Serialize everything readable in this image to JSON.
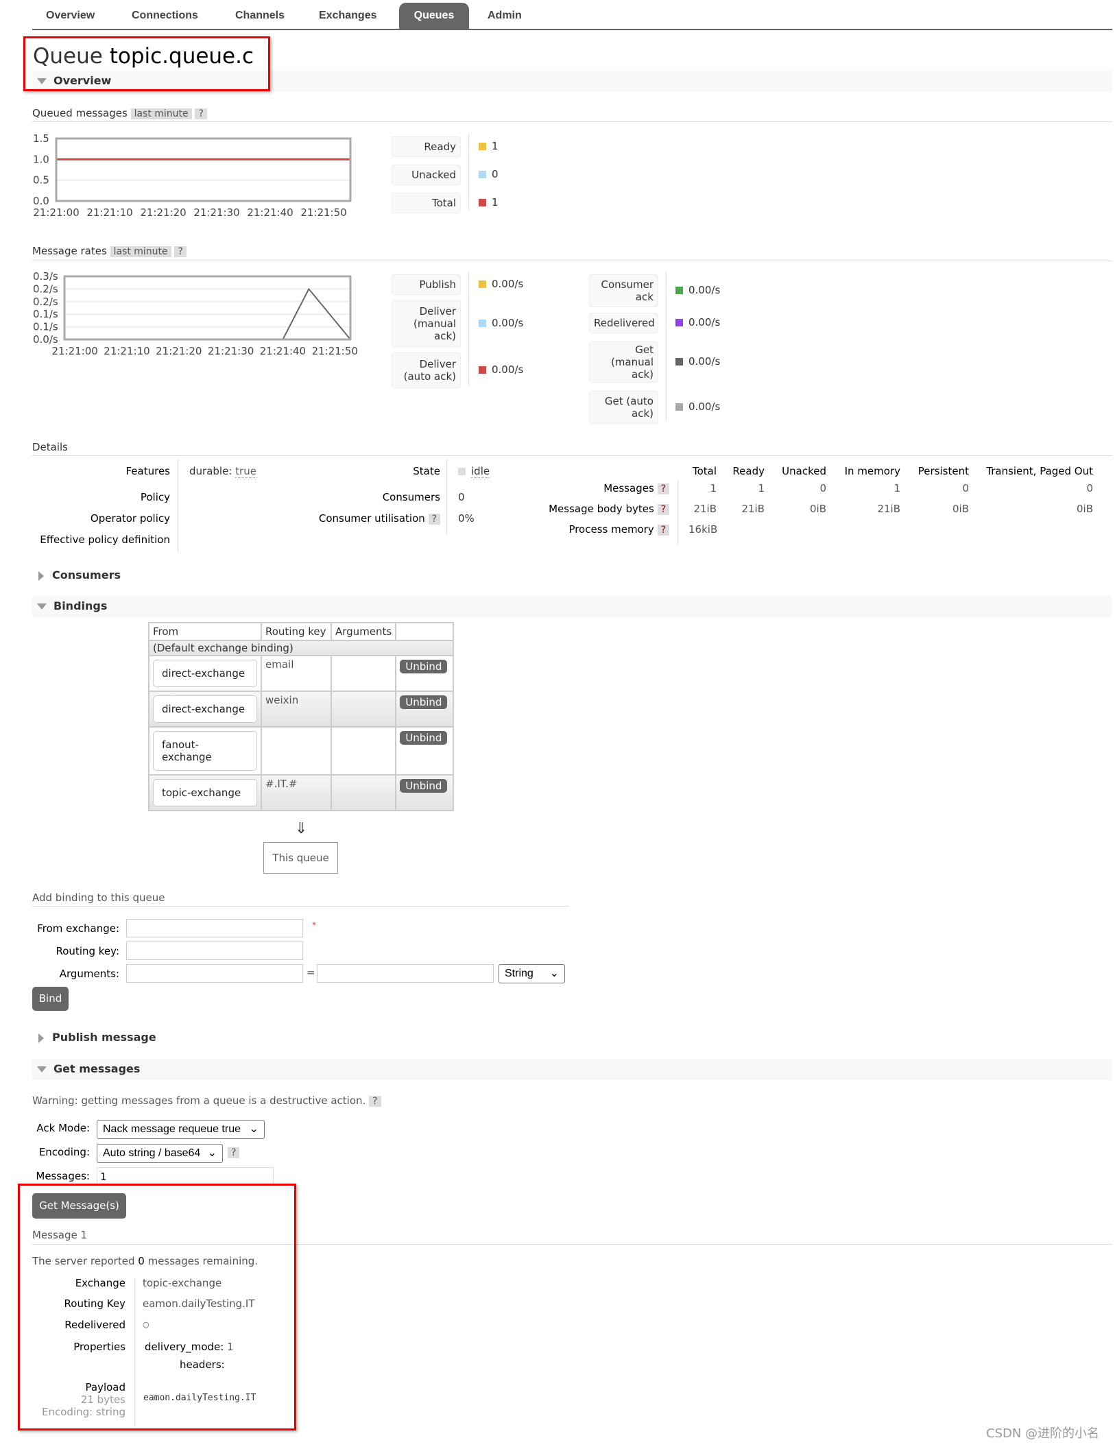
{
  "nav": {
    "tabs": [
      "Overview",
      "Connections",
      "Channels",
      "Exchanges",
      "Queues",
      "Admin"
    ],
    "active": "Queues"
  },
  "title": {
    "prefix": "Queue",
    "name": "topic.queue.c"
  },
  "overview": {
    "section": "Overview",
    "queued": {
      "label": "Queued messages",
      "range": "last minute",
      "help": "?",
      "legend": [
        {
          "label": "Ready",
          "value": "1",
          "color": "#edc240"
        },
        {
          "label": "Unacked",
          "value": "0",
          "color": "#afd8f8"
        },
        {
          "label": "Total",
          "value": "1",
          "color": "#cb4b4b"
        }
      ]
    },
    "rates": {
      "label": "Message rates",
      "range": "last minute",
      "help": "?",
      "legend1": [
        {
          "label": "Publish",
          "value": "0.00/s",
          "color": "#edc240"
        },
        {
          "label": "Deliver (manual ack)",
          "value": "0.00/s",
          "color": "#afd8f8"
        },
        {
          "label": "Deliver (auto ack)",
          "value": "0.00/s",
          "color": "#cb4b4b"
        }
      ],
      "legend2": [
        {
          "label": "Consumer ack",
          "value": "0.00/s",
          "color": "#4da74d"
        },
        {
          "label": "Redelivered",
          "value": "0.00/s",
          "color": "#9440ed"
        },
        {
          "label": "Get (manual ack)",
          "value": "0.00/s",
          "color": "#666666"
        },
        {
          "label": "Get (auto ack)",
          "value": "0.00/s",
          "color": "#aaaaaa"
        }
      ]
    }
  },
  "chart_data": [
    {
      "type": "line",
      "x_ticks": [
        "21:21:00",
        "21:21:10",
        "21:21:20",
        "21:21:30",
        "21:21:40",
        "21:21:50"
      ],
      "y_ticks": [
        "0.0",
        "0.5",
        "1.0",
        "1.5"
      ],
      "ylim": [
        0,
        1.5
      ],
      "xlim": [
        "21:21:00",
        "21:21:55"
      ],
      "grid": true,
      "series": [
        {
          "name": "Unacked",
          "color": "#afd8f8",
          "x": [
            "21:21:00",
            "21:21:55"
          ],
          "y": [
            0,
            0
          ]
        },
        {
          "name": "Ready",
          "color": "#edc240",
          "x": [
            "21:21:00",
            "21:21:55"
          ],
          "y": [
            1,
            1
          ]
        },
        {
          "name": "Total",
          "color": "#cb4b4b",
          "x": [
            "21:21:00",
            "21:21:55"
          ],
          "y": [
            1,
            1
          ]
        }
      ]
    },
    {
      "type": "line",
      "x_ticks": [
        "21:21:00",
        "21:21:10",
        "21:21:20",
        "21:21:30",
        "21:21:40",
        "21:21:50"
      ],
      "y_ticks": [
        "0.0/s",
        "0.1/s",
        "0.1/s",
        "0.2/s",
        "0.2/s",
        "0.3/s"
      ],
      "ylim": [
        0,
        0.25
      ],
      "xlim": [
        "21:20:58",
        "21:21:53"
      ],
      "grid": true,
      "series": [
        {
          "name": "Get (manual ack)",
          "color": "#666666",
          "x": [
            "21:20:58",
            "21:21:40",
            "21:21:45",
            "21:21:53"
          ],
          "y": [
            0,
            0,
            0.2,
            0
          ]
        }
      ]
    }
  ],
  "details": {
    "label": "Details",
    "left": [
      {
        "k": "Features",
        "v": "durable:",
        "v2": "true"
      },
      {
        "k": "Policy",
        "v": ""
      },
      {
        "k": "Operator policy",
        "v": ""
      },
      {
        "k": "Effective policy definition",
        "v": ""
      }
    ],
    "mid": [
      {
        "k": "State",
        "v": "idle"
      },
      {
        "k": "Consumers",
        "v": "0"
      },
      {
        "k": "Consumer utilisation",
        "v": "0%",
        "help": "?"
      }
    ],
    "cols": [
      "Total",
      "Ready",
      "Unacked",
      "In memory",
      "Persistent",
      "Transient, Paged Out"
    ],
    "rows": [
      {
        "k": "Messages",
        "v": [
          "1",
          "1",
          "0",
          "1",
          "0",
          "0"
        ]
      },
      {
        "k": "Message body bytes",
        "v": [
          "21iB",
          "21iB",
          "0iB",
          "21iB",
          "0iB",
          "0iB"
        ]
      },
      {
        "k": "Process memory",
        "v": [
          "16kiB"
        ]
      }
    ]
  },
  "consumers": {
    "label": "Consumers"
  },
  "bindings": {
    "label": "Bindings",
    "headers": [
      "From",
      "Routing key",
      "Arguments",
      ""
    ],
    "default": "(Default exchange binding)",
    "rows": [
      {
        "from": "direct-exchange",
        "key": "email"
      },
      {
        "from": "direct-exchange",
        "key": "weixin"
      },
      {
        "from": "fanout-exchange",
        "key": ""
      },
      {
        "from": "topic-exchange",
        "key": "#.IT.#"
      }
    ],
    "unbind": "Unbind",
    "arrow": "⇓",
    "this_queue": "This queue"
  },
  "add_binding": {
    "label": "Add binding to this queue",
    "from_label": "From exchange:",
    "required": "*",
    "key_label": "Routing key:",
    "args_label": "Arguments:",
    "eq": "=",
    "type": "String",
    "bind": "Bind"
  },
  "publish": {
    "label": "Publish message"
  },
  "get": {
    "label": "Get messages",
    "warning": "Warning: getting messages from a queue is a destructive action.",
    "help": "?",
    "ack_label": "Ack Mode:",
    "ack": "Nack message requeue true",
    "enc_label": "Encoding:",
    "enc": "Auto string / base64",
    "msgs_label": "Messages:",
    "msgs": "1",
    "button": "Get Message(s)"
  },
  "result": {
    "title": "Message 1",
    "pre": "The server reported ",
    "count": "0",
    "post": " messages remaining.",
    "exchange_k": "Exchange",
    "exchange": "topic-exchange",
    "rk_k": "Routing Key",
    "rk": "eamon.dailyTesting.IT",
    "red_k": "Redelivered",
    "red": "○",
    "props_k": "Properties",
    "props_1": "delivery_mode:",
    "props_1v": "1",
    "props_2": "headers:",
    "payload_k": "Payload",
    "bytes": "21 bytes",
    "encoding": "Encoding: string",
    "payload": "eamon.dailyTesting.IT"
  },
  "watermark": "CSDN @进阶的小名"
}
